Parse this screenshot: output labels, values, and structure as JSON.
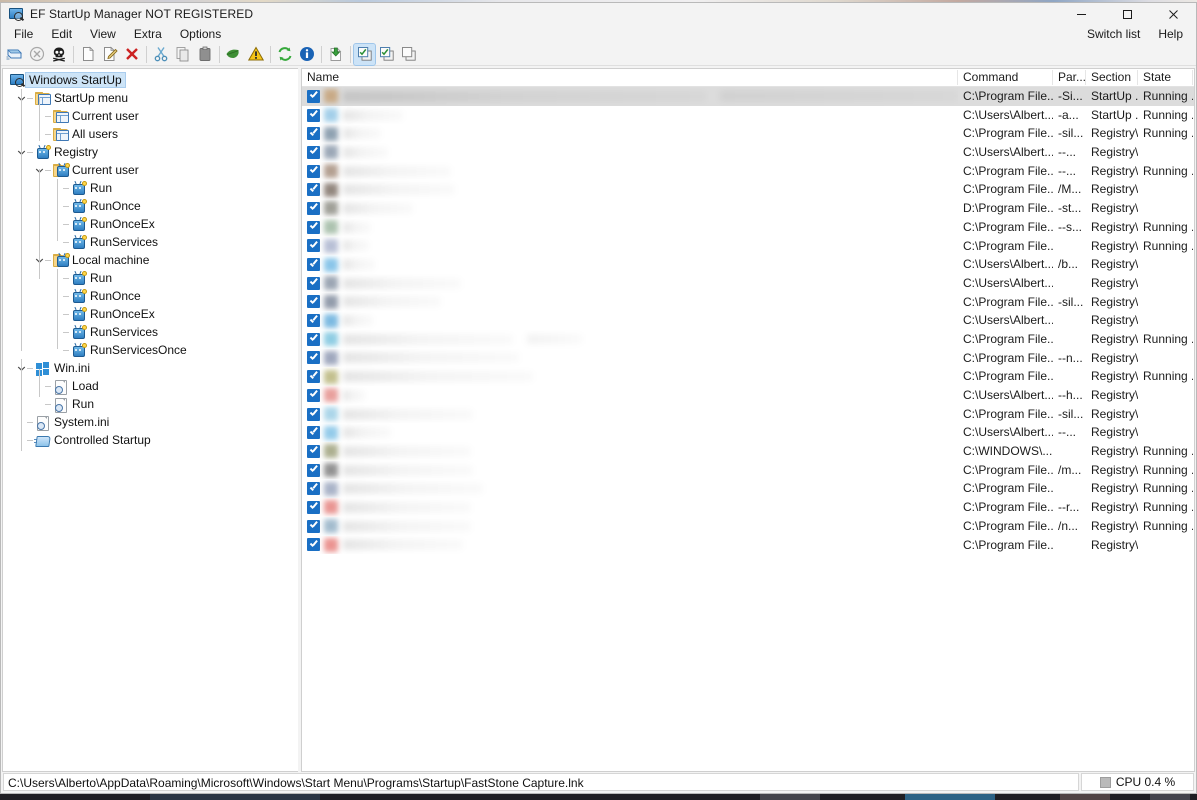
{
  "window": {
    "title": "EF StartUp Manager NOT REGISTERED",
    "icon": "app-screen-magnifier-icon",
    "minimize_label": "—",
    "maximize_label": "☐",
    "close_label": "✕"
  },
  "menu": {
    "items": [
      "File",
      "Edit",
      "View",
      "Extra",
      "Options"
    ],
    "right_items": [
      "Switch list",
      "Help"
    ]
  },
  "toolbar": {
    "buttons": [
      {
        "name": "open-list-icon",
        "glyph": "open-window"
      },
      {
        "name": "disable-icon",
        "glyph": "circle-x"
      },
      {
        "name": "remove-malware-icon",
        "glyph": "skull"
      },
      {
        "name": "new-entry-icon",
        "glyph": "page"
      },
      {
        "name": "edit-entry-icon",
        "glyph": "page-pencil"
      },
      {
        "name": "delete-entry-icon",
        "glyph": "red-x"
      },
      {
        "name": "cut-icon",
        "glyph": "scissors"
      },
      {
        "name": "copy-icon",
        "glyph": "copy-pages"
      },
      {
        "name": "paste-icon",
        "glyph": "clipboard"
      },
      {
        "name": "leaf-icon",
        "glyph": "green-leaf"
      },
      {
        "name": "warning-icon",
        "glyph": "yellow-triangle"
      },
      {
        "name": "refresh-icon",
        "glyph": "green-arrows"
      },
      {
        "name": "info-icon",
        "glyph": "blue-info"
      },
      {
        "name": "import-icon",
        "glyph": "green-down-arrow-page"
      },
      {
        "name": "check-all-icon",
        "glyph": "checked-windows"
      },
      {
        "name": "check-selected-icon",
        "glyph": "checked-windows-2"
      },
      {
        "name": "uncheck-all-icon",
        "glyph": "plain-windows"
      }
    ]
  },
  "tree": {
    "root": {
      "label": "Windows StartUp",
      "icon": "app-screen-magnifier-icon",
      "selected": true
    },
    "nodes": [
      {
        "label": "StartUp menu",
        "icon": "window-folder-icon",
        "depth": 1,
        "expanded": true
      },
      {
        "label": "Current user",
        "icon": "window-folder-icon",
        "depth": 2
      },
      {
        "label": "All users",
        "icon": "window-folder-icon",
        "depth": 2
      },
      {
        "label": "Registry",
        "icon": "registry-bug-icon",
        "depth": 1,
        "expanded": true
      },
      {
        "label": "Current user",
        "icon": "registry-folder-icon",
        "depth": 2,
        "expanded": true
      },
      {
        "label": "Run",
        "icon": "registry-bug-icon",
        "depth": 3
      },
      {
        "label": "RunOnce",
        "icon": "registry-bug-icon",
        "depth": 3
      },
      {
        "label": "RunOnceEx",
        "icon": "registry-bug-icon",
        "depth": 3
      },
      {
        "label": "RunServices",
        "icon": "registry-bug-icon",
        "depth": 3
      },
      {
        "label": "Local machine",
        "icon": "registry-folder-icon",
        "depth": 2,
        "expanded": true
      },
      {
        "label": "Run",
        "icon": "registry-bug-icon",
        "depth": 3
      },
      {
        "label": "RunOnce",
        "icon": "registry-bug-icon",
        "depth": 3
      },
      {
        "label": "RunOnceEx",
        "icon": "registry-bug-icon",
        "depth": 3
      },
      {
        "label": "RunServices",
        "icon": "registry-bug-icon",
        "depth": 3
      },
      {
        "label": "RunServicesOnce",
        "icon": "registry-bug-icon",
        "depth": 3
      },
      {
        "label": "Win.ini",
        "icon": "windows-logo-icon",
        "depth": 1,
        "expanded": true
      },
      {
        "label": "Load",
        "icon": "ini-file-icon",
        "depth": 2
      },
      {
        "label": "Run",
        "icon": "ini-file-icon",
        "depth": 2
      },
      {
        "label": "System.ini",
        "icon": "ini-file-icon",
        "depth": 1
      },
      {
        "label": "Controlled Startup",
        "icon": "controlled-startup-icon",
        "depth": 1
      }
    ]
  },
  "list": {
    "columns": [
      {
        "key": "name",
        "label": "Name"
      },
      {
        "key": "command",
        "label": "Command"
      },
      {
        "key": "parameters",
        "label": "Par..."
      },
      {
        "key": "section",
        "label": "Section"
      },
      {
        "key": "state",
        "label": "State"
      }
    ],
    "rows": [
      {
        "checked": true,
        "name": "",
        "command": "C:\\Program File...",
        "parameters": "-Si...",
        "section": "StartUp ...",
        "state": "Running ...",
        "selected": true,
        "icon_color": "#c8a882",
        "bar1": 365,
        "bar2": 240
      },
      {
        "checked": true,
        "name": "",
        "command": "C:\\Users\\Albert...",
        "parameters": "-a...",
        "section": "StartUp ...",
        "state": "Running ...",
        "icon_color": "#9fcde8",
        "bar1": 60,
        "bar2": 0
      },
      {
        "checked": true,
        "name": "",
        "command": "C:\\Program File...",
        "parameters": "-sil...",
        "section": "Registry\\...",
        "state": "Running ...",
        "icon_color": "#8a9dae",
        "bar1": 38,
        "bar2": 0
      },
      {
        "checked": true,
        "name": "",
        "command": "C:\\Users\\Albert...",
        "parameters": "--...",
        "section": "Registry\\...",
        "state": "",
        "icon_color": "#97a4b4",
        "bar1": 45,
        "bar2": 0
      },
      {
        "checked": true,
        "name": "",
        "command": "C:\\Program File...",
        "parameters": "--...",
        "section": "Registry\\...",
        "state": "Running ...",
        "icon_color": "#b09b8c",
        "bar1": 108,
        "bar2": 0
      },
      {
        "checked": true,
        "name": "",
        "command": "C:\\Program File...",
        "parameters": "/M...",
        "section": "Registry\\...",
        "state": "",
        "icon_color": "#8d8178",
        "bar1": 112,
        "bar2": 0
      },
      {
        "checked": true,
        "name": "",
        "command": "D:\\Program File...",
        "parameters": "-st...",
        "section": "Registry\\...",
        "state": "",
        "icon_color": "#9b9b93",
        "bar1": 70,
        "bar2": 0
      },
      {
        "checked": true,
        "name": "",
        "command": "C:\\Program File...",
        "parameters": "--s...",
        "section": "Registry\\...",
        "state": "Running ...",
        "icon_color": "#a9c0ac",
        "bar1": 28,
        "bar2": 0
      },
      {
        "checked": true,
        "name": "",
        "command": "C:\\Program File...",
        "parameters": "",
        "section": "Registry\\...",
        "state": "Running ...",
        "icon_color": "#b5bdd4",
        "bar1": 26,
        "bar2": 0
      },
      {
        "checked": true,
        "name": "",
        "command": "C:\\Users\\Albert...",
        "parameters": "/b...",
        "section": "Registry\\...",
        "state": "",
        "icon_color": "#84c3e8",
        "bar1": 32,
        "bar2": 0
      },
      {
        "checked": true,
        "name": "",
        "command": "C:\\Users\\Albert...",
        "parameters": "",
        "section": "Registry\\...",
        "state": "",
        "icon_color": "#97a2b0",
        "bar1": 118,
        "bar2": 0
      },
      {
        "checked": true,
        "name": "",
        "command": "C:\\Program File...",
        "parameters": "-sil...",
        "section": "Registry\\...",
        "state": "",
        "icon_color": "#8e98a8",
        "bar1": 98,
        "bar2": 0
      },
      {
        "checked": true,
        "name": "",
        "command": "C:\\Users\\Albert...",
        "parameters": "",
        "section": "Registry\\...",
        "state": "",
        "icon_color": "#76b7e0",
        "bar1": 30,
        "bar2": 0
      },
      {
        "checked": true,
        "name": "",
        "command": "C:\\Program File...",
        "parameters": "",
        "section": "Registry\\...",
        "state": "Running ...",
        "icon_color": "#89cbe2",
        "bar1": 170,
        "bar2": 55
      },
      {
        "checked": true,
        "name": "",
        "command": "C:\\Program File...",
        "parameters": "--n...",
        "section": "Registry\\...",
        "state": "",
        "icon_color": "#9ba4bb",
        "bar1": 176,
        "bar2": 0
      },
      {
        "checked": true,
        "name": "",
        "command": "C:\\Program File...",
        "parameters": "",
        "section": "Registry\\...",
        "state": "Running ...",
        "icon_color": "#c0bd88",
        "bar1": 190,
        "bar2": 0
      },
      {
        "checked": true,
        "name": "",
        "command": "C:\\Users\\Albert...",
        "parameters": "--h...",
        "section": "Registry\\...",
        "state": "",
        "icon_color": "#e79b98",
        "bar1": 22,
        "bar2": 0
      },
      {
        "checked": true,
        "name": "",
        "command": "C:\\Program File...",
        "parameters": "-sil...",
        "section": "Registry\\...",
        "state": "",
        "icon_color": "#a8d4e8",
        "bar1": 130,
        "bar2": 0
      },
      {
        "checked": true,
        "name": "",
        "command": "C:\\Users\\Albert...",
        "parameters": "--...",
        "section": "Registry\\...",
        "state": "",
        "icon_color": "#8fc9e9",
        "bar1": 48,
        "bar2": 0
      },
      {
        "checked": true,
        "name": "",
        "command": "C:\\WINDOWS\\...",
        "parameters": "",
        "section": "Registry\\...",
        "state": "Running ...",
        "icon_color": "#a9ac8b",
        "bar1": 128,
        "bar2": 0
      },
      {
        "checked": true,
        "name": "",
        "command": "C:\\Program File...",
        "parameters": "/m...",
        "section": "Registry\\...",
        "state": "Running ...",
        "icon_color": "#8d8d8d",
        "bar1": 130,
        "bar2": 0
      },
      {
        "checked": true,
        "name": "",
        "command": "C:\\Program File...",
        "parameters": "",
        "section": "Registry\\...",
        "state": "Running ...",
        "icon_color": "#a6b0c6",
        "bar1": 140,
        "bar2": 0
      },
      {
        "checked": true,
        "name": "",
        "command": "C:\\Program File...",
        "parameters": "--r...",
        "section": "Registry\\...",
        "state": "Running ...",
        "icon_color": "#e8918e",
        "bar1": 128,
        "bar2": 0
      },
      {
        "checked": true,
        "name": "",
        "command": "C:\\Program File...",
        "parameters": "/n...",
        "section": "Registry\\...",
        "state": "Running ...",
        "icon_color": "#9fb9cc",
        "bar1": 128,
        "bar2": 0
      },
      {
        "checked": true,
        "name": "",
        "command": "C:\\Program File...",
        "parameters": "",
        "section": "Registry\\...",
        "state": "",
        "icon_color": "#ea8f8c",
        "bar1": 120,
        "bar2": 0
      }
    ]
  },
  "statusbar": {
    "path": "C:\\Users\\Alberto\\AppData\\Roaming\\Microsoft\\Windows\\Start Menu\\Programs\\Startup\\FastStone Capture.lnk",
    "cpu": "CPU 0.4 %"
  },
  "colors": {
    "accent": "#1a6fc4",
    "selection": "#dcdcdc",
    "tree_selection": "#cde4f7",
    "window_bg": "#f3f3f3"
  }
}
